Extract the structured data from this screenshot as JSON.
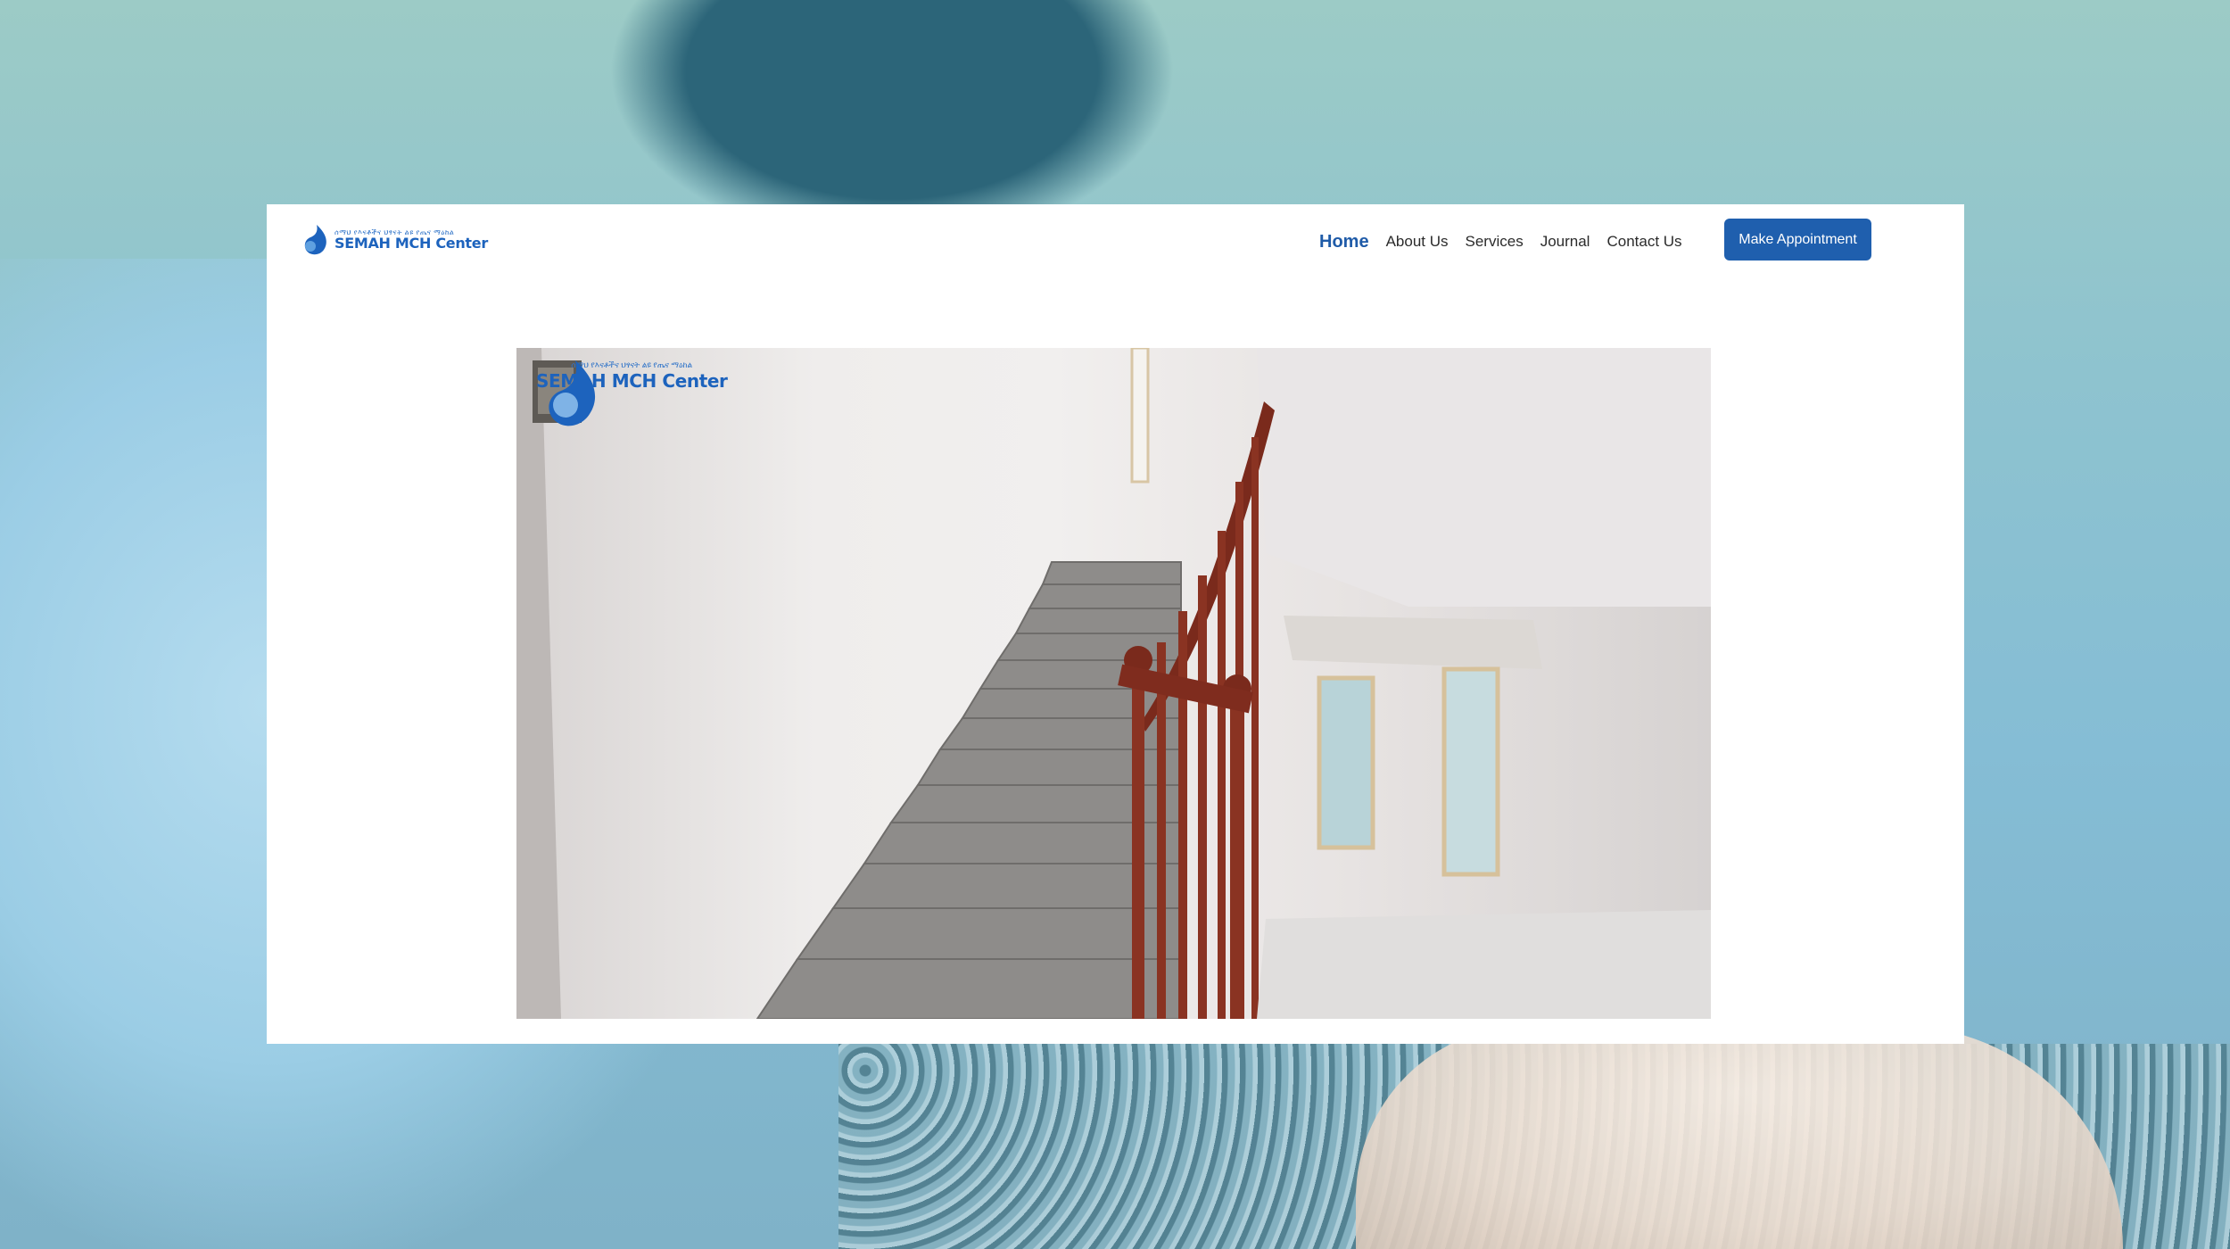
{
  "brand": {
    "name": "SEMAH MCH Center",
    "tagline": "ሰማህ የእናቶችና ህፃናት ልዩ የጤና ማዕከል"
  },
  "nav": {
    "items": [
      {
        "label": "Home",
        "active": true
      },
      {
        "label": "About Us",
        "active": false
      },
      {
        "label": "Services",
        "active": false
      },
      {
        "label": "Journal",
        "active": false
      },
      {
        "label": "Contact Us",
        "active": false
      }
    ],
    "cta_label": "Make Appointment"
  },
  "hero": {
    "image_description_icon": "staircase-photo",
    "watermark": {
      "name": "SEMAH MCH Center",
      "tagline": "ሰማህ የእናቶችና ህፃናት ልዩ የጤና ማዕከል"
    }
  },
  "colors": {
    "brand_blue": "#1d63bd",
    "cta_background": "#1f5fae",
    "active_nav": "#1f5ba8",
    "card_background": "#ffffff"
  }
}
